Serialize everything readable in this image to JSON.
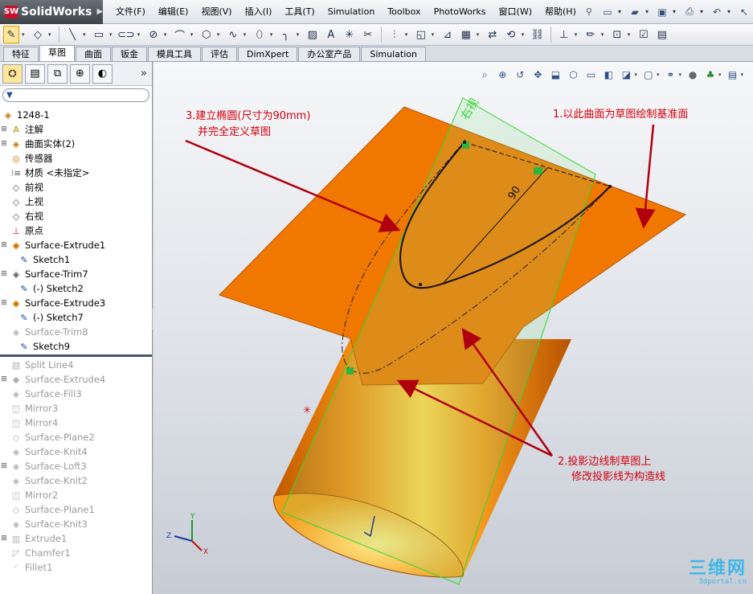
{
  "app": {
    "name": "SolidWorks"
  },
  "menu": [
    "文件(F)",
    "编辑(E)",
    "视图(V)",
    "插入(I)",
    "工具(T)",
    "Simulation",
    "Toolbox",
    "PhotoWorks",
    "窗口(W)",
    "帮助(H)"
  ],
  "tabs": [
    "特征",
    "草图",
    "曲面",
    "钣金",
    "模具工具",
    "评估",
    "DimXpert",
    "办公室产品",
    "Simulation"
  ],
  "active_tab": "草图",
  "tree": {
    "root": "1248-1",
    "items": [
      {
        "label": "注解",
        "icon": "annotation-icon",
        "expandable": true
      },
      {
        "label": "曲面实体(2)",
        "icon": "surface-bodies-icon",
        "expandable": true
      },
      {
        "label": "传感器",
        "icon": "sensor-icon",
        "expandable": false
      },
      {
        "label": "材质 <未指定>",
        "icon": "material-icon",
        "expandable": false
      },
      {
        "label": "前视",
        "icon": "plane-icon",
        "expandable": false
      },
      {
        "label": "上视",
        "icon": "plane-icon",
        "expandable": false
      },
      {
        "label": "右视",
        "icon": "plane-icon",
        "expandable": false
      },
      {
        "label": "原点",
        "icon": "origin-icon",
        "expandable": false
      },
      {
        "label": "Surface-Extrude1",
        "icon": "surface-extrude-icon",
        "expandable": true
      },
      {
        "label": "Sketch1",
        "icon": "sketch-icon",
        "sub": true
      },
      {
        "label": "Surface-Trim7",
        "icon": "surface-trim-icon",
        "expandable": true
      },
      {
        "label": "(-) Sketch2",
        "icon": "sketch-icon",
        "sub": true
      },
      {
        "label": "Surface-Extrude3",
        "icon": "surface-extrude-icon",
        "expandable": true
      },
      {
        "label": "(-) Sketch7",
        "icon": "sketch-icon",
        "sub": true
      },
      {
        "label": "Surface-Trim8",
        "icon": "surface-trim-icon",
        "grey": true
      },
      {
        "label": "Sketch9",
        "icon": "sketch-icon",
        "sub": true
      }
    ],
    "suppressed": [
      {
        "label": "Split Line4",
        "icon": "split-line-icon",
        "expandable": false
      },
      {
        "label": "Surface-Extrude4",
        "icon": "surface-extrude-icon",
        "expandable": true
      },
      {
        "label": "Surface-Fill3",
        "icon": "surface-fill-icon",
        "expandable": false
      },
      {
        "label": "Mirror3",
        "icon": "mirror-icon",
        "expandable": false
      },
      {
        "label": "Mirror4",
        "icon": "mirror-icon",
        "expandable": false
      },
      {
        "label": "Surface-Plane2",
        "icon": "surface-plane-icon",
        "expandable": false
      },
      {
        "label": "Surface-Knit4",
        "icon": "surface-knit-icon",
        "expandable": false
      },
      {
        "label": "Surface-Loft3",
        "icon": "surface-loft-icon",
        "expandable": true
      },
      {
        "label": "Surface-Knit2",
        "icon": "surface-knit-icon",
        "expandable": false
      },
      {
        "label": "Mirror2",
        "icon": "mirror-icon",
        "expandable": false
      },
      {
        "label": "Surface-Plane1",
        "icon": "surface-plane-icon",
        "expandable": false
      },
      {
        "label": "Surface-Knit3",
        "icon": "surface-knit-icon",
        "expandable": false
      },
      {
        "label": "Extrude1",
        "icon": "extrude-icon",
        "expandable": true
      },
      {
        "label": "Chamfer1",
        "icon": "chamfer-icon",
        "expandable": false
      },
      {
        "label": "Fillet1",
        "icon": "fillet-icon",
        "expandable": false
      }
    ]
  },
  "viewport": {
    "plane_label": "右视",
    "dimension": "90",
    "notes": [
      {
        "id": "note1",
        "text": "1.以此曲面为草图绘制基准面"
      },
      {
        "id": "note2a",
        "text": "2.投影边线制草图上"
      },
      {
        "id": "note2b",
        "text": "修改投影线为构造线"
      },
      {
        "id": "note3a",
        "text": "3.建立椭圆(尺寸为90mm)"
      },
      {
        "id": "note3b",
        "text": "并完全定义草图"
      }
    ],
    "axes": {
      "x": "X",
      "y": "Y",
      "z": "Z"
    }
  },
  "watermark": {
    "main": "三维网",
    "sub": "3dportal.cn"
  },
  "colors": {
    "surface": "#f07800",
    "annotation": "#d2000f",
    "plane_outline": "#33d633"
  }
}
